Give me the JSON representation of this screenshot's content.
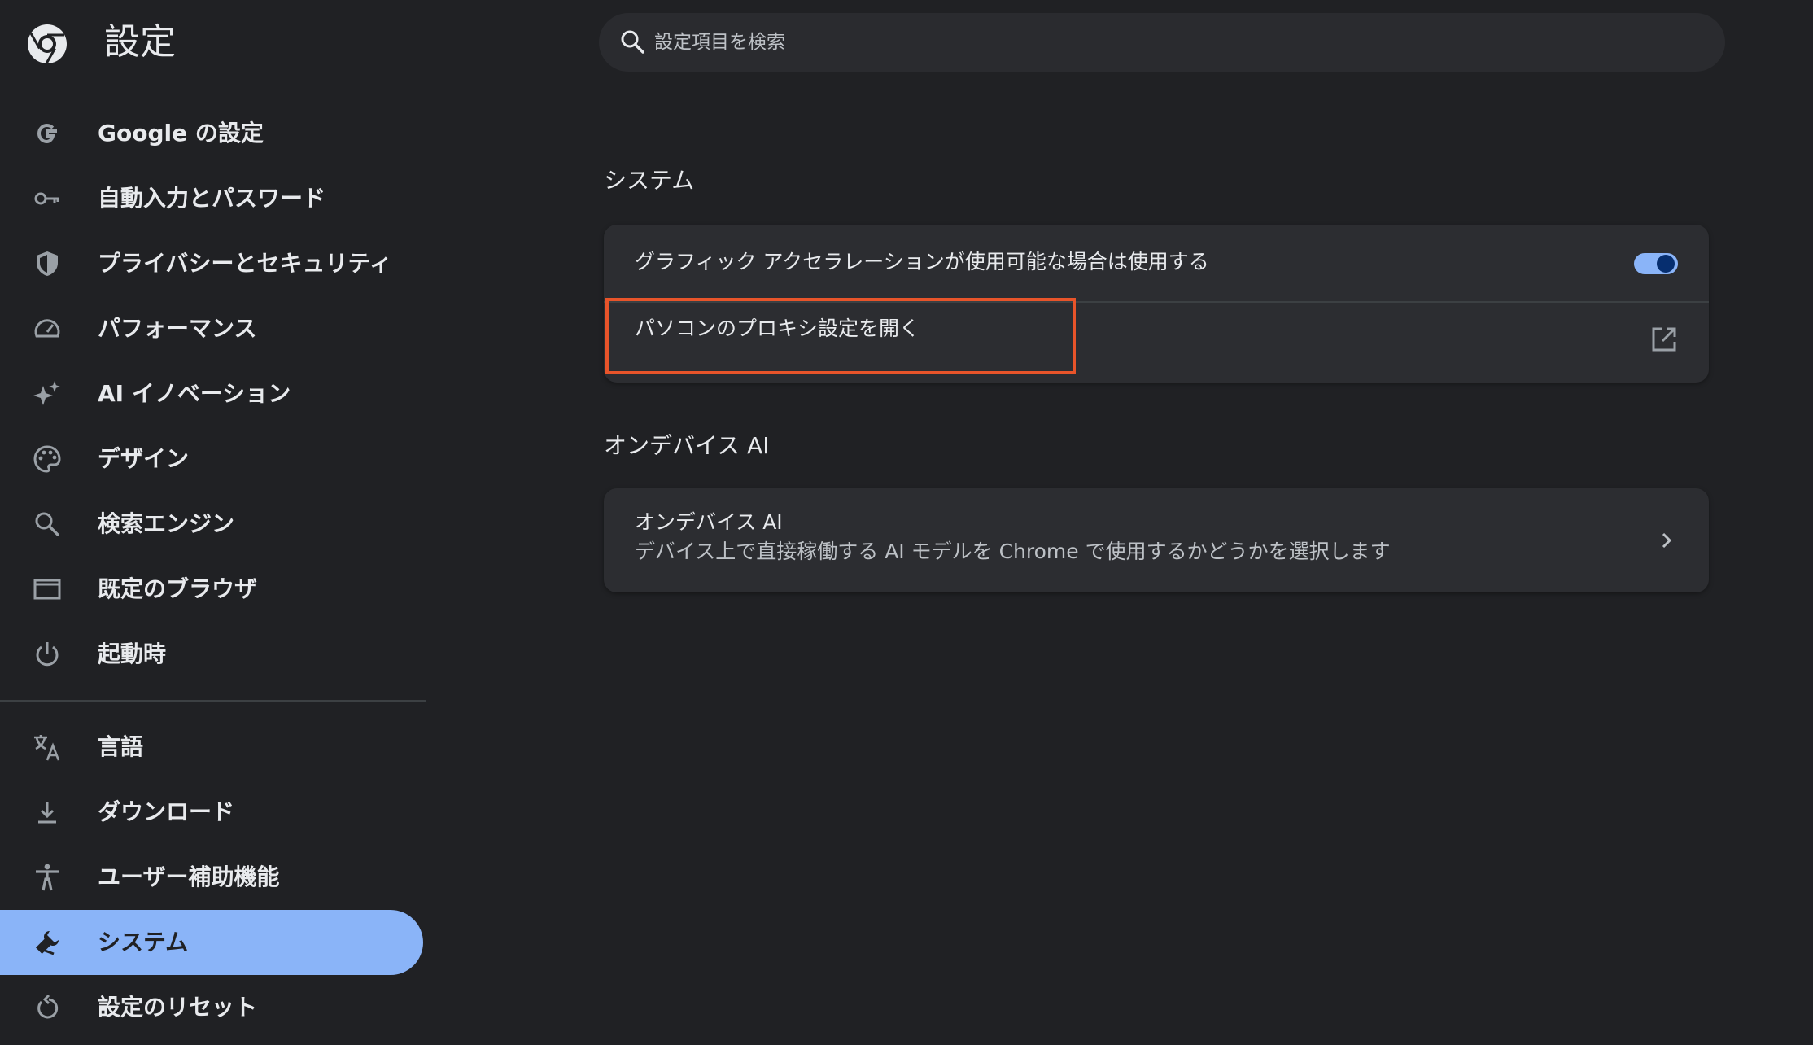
{
  "header": {
    "title": "設定",
    "logo_icon": "chrome-logo-icon"
  },
  "search": {
    "placeholder": "設定項目を検索",
    "value": "",
    "icon": "search-icon"
  },
  "sidebar": {
    "items": [
      {
        "label": "Google の設定",
        "icon": "google-g-icon",
        "active": false
      },
      {
        "label": "自動入力とパスワード",
        "icon": "key-icon",
        "active": false
      },
      {
        "label": "プライバシーとセキュリティ",
        "icon": "shield-icon",
        "active": false
      },
      {
        "label": "パフォーマンス",
        "icon": "speedometer-icon",
        "active": false
      },
      {
        "label": "AI イノベーション",
        "icon": "sparkle-icon",
        "active": false
      },
      {
        "label": "デザイン",
        "icon": "palette-icon",
        "active": false
      },
      {
        "label": "検索エンジン",
        "icon": "search-icon",
        "active": false
      },
      {
        "label": "既定のブラウザ",
        "icon": "browser-window-icon",
        "active": false
      },
      {
        "label": "起動時",
        "icon": "power-icon",
        "active": false
      },
      {
        "label": "言語",
        "icon": "translate-icon",
        "active": false
      },
      {
        "label": "ダウンロード",
        "icon": "download-icon",
        "active": false
      },
      {
        "label": "ユーザー補助機能",
        "icon": "accessibility-icon",
        "active": false
      },
      {
        "label": "システム",
        "icon": "wrench-icon",
        "active": true
      },
      {
        "label": "設定のリセット",
        "icon": "reset-icon",
        "active": false
      }
    ]
  },
  "main": {
    "system_section": {
      "title": "システム",
      "graphics_acceleration": {
        "label": "グラフィック アクセラレーションが使用可能な場合は使用する",
        "enabled": true
      },
      "proxy": {
        "label": "パソコンのプロキシ設定を開く",
        "icon": "open-in-new-icon"
      }
    },
    "on_device_ai_section": {
      "title": "オンデバイス AI",
      "row": {
        "label": "オンデバイス AI",
        "description": "デバイス上で直接稼働する AI モデルを Chrome で使用するかどうかを選択します",
        "icon": "chevron-right-icon"
      }
    }
  },
  "colors": {
    "background": "#202124",
    "card": "#2c2d31",
    "accent": "#8ab4f8",
    "highlight": "#e8542a",
    "toggle_knob": "#062e6f"
  }
}
